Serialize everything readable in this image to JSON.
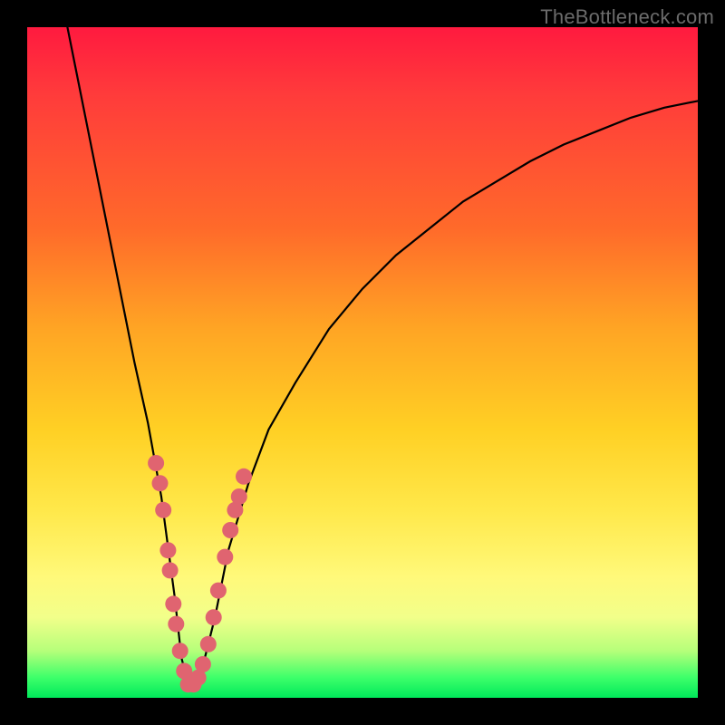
{
  "watermark": "TheBottleneck.com",
  "colors": {
    "frame": "#000000",
    "curve": "#000000",
    "dot_fill": "#e06470",
    "dot_border": "#c44a56",
    "gradient_top": "#ff1a3f",
    "gradient_bottom": "#00e85a"
  },
  "chart_data": {
    "type": "line",
    "title": "",
    "xlabel": "",
    "ylabel": "",
    "xlim": [
      0,
      100
    ],
    "ylim": [
      0,
      100
    ],
    "series": [
      {
        "name": "bottleneck-curve",
        "x": [
          6,
          8,
          10,
          12,
          14,
          16,
          18,
          20,
          22,
          23,
          24,
          25,
          26,
          28,
          30,
          33,
          36,
          40,
          45,
          50,
          55,
          60,
          65,
          70,
          75,
          80,
          85,
          90,
          95,
          100
        ],
        "y": [
          100,
          90,
          80,
          70,
          60,
          50,
          41,
          30,
          15,
          6,
          2,
          2,
          4,
          12,
          22,
          32,
          40,
          47,
          55,
          61,
          66,
          70,
          74,
          77,
          80,
          82.5,
          84.5,
          86.5,
          88,
          89
        ]
      }
    ],
    "marker_cluster": {
      "name": "sample-dots",
      "points": [
        {
          "x": 19.2,
          "y": 35
        },
        {
          "x": 19.8,
          "y": 32
        },
        {
          "x": 20.3,
          "y": 28
        },
        {
          "x": 21.0,
          "y": 22
        },
        {
          "x": 21.3,
          "y": 19
        },
        {
          "x": 21.8,
          "y": 14
        },
        {
          "x": 22.2,
          "y": 11
        },
        {
          "x": 22.8,
          "y": 7
        },
        {
          "x": 23.4,
          "y": 4
        },
        {
          "x": 24.0,
          "y": 2
        },
        {
          "x": 24.8,
          "y": 2
        },
        {
          "x": 25.5,
          "y": 3
        },
        {
          "x": 26.2,
          "y": 5
        },
        {
          "x": 27.0,
          "y": 8
        },
        {
          "x": 27.8,
          "y": 12
        },
        {
          "x": 28.5,
          "y": 16
        },
        {
          "x": 29.5,
          "y": 21
        },
        {
          "x": 30.3,
          "y": 25
        },
        {
          "x": 31.0,
          "y": 28
        },
        {
          "x": 31.6,
          "y": 30
        },
        {
          "x": 32.3,
          "y": 33
        }
      ]
    }
  }
}
